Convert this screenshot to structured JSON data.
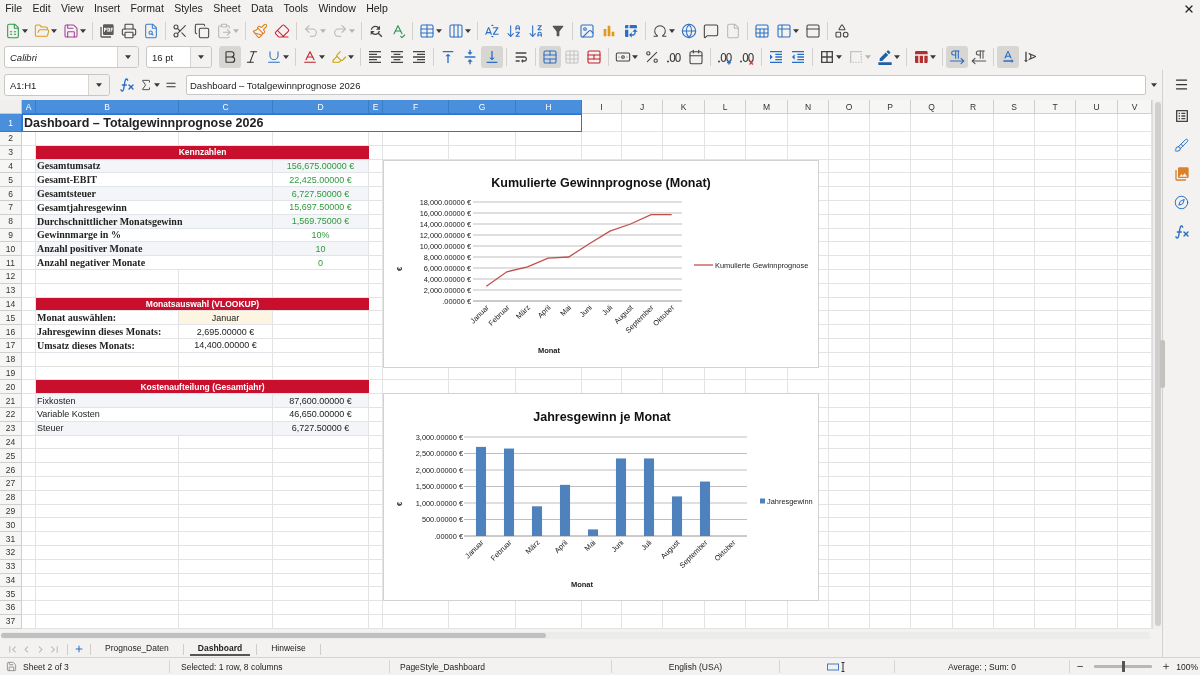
{
  "menu_bar": {
    "items": [
      "File",
      "Edit",
      "View",
      "Insert",
      "Format",
      "Styles",
      "Sheet",
      "Data",
      "Tools",
      "Window",
      "Help"
    ]
  },
  "standard_toolbar": {
    "groups": [
      [
        {
          "kind": "new",
          "dropdown": true,
          "disabled": false
        },
        {
          "kind": "open",
          "dropdown": true,
          "disabled": false
        },
        {
          "kind": "save",
          "dropdown": true,
          "disabled": false
        }
      ],
      [
        {
          "kind": "pdf",
          "dropdown": false,
          "disabled": false
        },
        {
          "kind": "print",
          "dropdown": false,
          "disabled": false
        },
        {
          "kind": "preview",
          "dropdown": false,
          "disabled": false
        }
      ],
      [
        {
          "kind": "cut",
          "dropdown": false,
          "disabled": false
        },
        {
          "kind": "copy",
          "dropdown": false,
          "disabled": false
        },
        {
          "kind": "paste",
          "dropdown": true,
          "disabled": true
        }
      ],
      [
        {
          "kind": "brush",
          "dropdown": false,
          "disabled": false
        },
        {
          "kind": "clear",
          "dropdown": false,
          "disabled": false
        }
      ],
      [
        {
          "kind": "undo",
          "dropdown": true,
          "disabled": true
        },
        {
          "kind": "redo",
          "dropdown": true,
          "disabled": true
        }
      ],
      [
        {
          "kind": "find",
          "dropdown": false,
          "disabled": false
        },
        {
          "kind": "spelling",
          "dropdown": false,
          "disabled": false
        }
      ],
      [
        {
          "kind": "rows",
          "dropdown": true,
          "disabled": false
        },
        {
          "kind": "columns",
          "dropdown": true,
          "disabled": false
        }
      ],
      [
        {
          "kind": "sort",
          "dropdown": false,
          "disabled": false
        },
        {
          "kind": "ascending",
          "dropdown": false,
          "disabled": false
        },
        {
          "kind": "descending",
          "dropdown": false,
          "disabled": false
        },
        {
          "kind": "filter",
          "dropdown": false,
          "disabled": false
        }
      ],
      [
        {
          "kind": "image",
          "dropdown": false,
          "disabled": false
        },
        {
          "kind": "chart",
          "dropdown": false,
          "disabled": false
        },
        {
          "kind": "pivot",
          "dropdown": false,
          "disabled": false
        }
      ],
      [
        {
          "kind": "symbol",
          "dropdown": true,
          "disabled": false
        },
        {
          "kind": "link",
          "dropdown": false,
          "disabled": false
        },
        {
          "kind": "comment",
          "dropdown": false,
          "disabled": false
        },
        {
          "kind": "header",
          "dropdown": false,
          "disabled": true
        }
      ],
      [
        {
          "kind": "printarea",
          "dropdown": false,
          "disabled": false
        },
        {
          "kind": "freeze",
          "dropdown": true,
          "disabled": false
        },
        {
          "kind": "split",
          "dropdown": false,
          "disabled": false
        }
      ],
      [
        {
          "kind": "shapes",
          "dropdown": false,
          "disabled": false
        }
      ]
    ]
  },
  "formatting_toolbar": {
    "font_name": "Calibri",
    "font_size": "16 pt",
    "groups": [
      [
        {
          "kind": "bold",
          "dropdown": false,
          "disabled": false,
          "active": true
        },
        {
          "kind": "italic",
          "dropdown": false,
          "disabled": false,
          "active": false
        },
        {
          "kind": "underline",
          "dropdown": true,
          "disabled": false,
          "active": false
        }
      ],
      [
        {
          "kind": "fontcolor",
          "dropdown": true,
          "disabled": false,
          "active": false
        },
        {
          "kind": "highlight",
          "dropdown": true,
          "disabled": false,
          "active": false
        }
      ],
      [
        {
          "kind": "left",
          "dropdown": false,
          "disabled": false,
          "active": false
        },
        {
          "kind": "center",
          "dropdown": false,
          "disabled": false,
          "active": false
        },
        {
          "kind": "right",
          "dropdown": false,
          "disabled": false,
          "active": false
        }
      ],
      [
        {
          "kind": "top",
          "dropdown": false,
          "disabled": false,
          "active": false
        },
        {
          "kind": "middle",
          "dropdown": false,
          "disabled": false,
          "active": false
        },
        {
          "kind": "bottom",
          "dropdown": false,
          "disabled": false,
          "active": true
        }
      ],
      [
        {
          "kind": "wrap",
          "dropdown": false,
          "disabled": false,
          "active": false
        }
      ],
      [
        {
          "kind": "mergecenter",
          "dropdown": false,
          "disabled": false,
          "active": true
        },
        {
          "kind": "merge",
          "dropdown": false,
          "disabled": true,
          "active": false
        },
        {
          "kind": "unmerge",
          "dropdown": false,
          "disabled": false,
          "active": false
        }
      ],
      [
        {
          "kind": "currency",
          "dropdown": true,
          "disabled": false,
          "active": false
        },
        {
          "kind": "percent",
          "dropdown": false,
          "disabled": false,
          "active": false
        },
        {
          "kind": "number",
          "dropdown": false,
          "disabled": false,
          "active": false
        },
        {
          "kind": "date",
          "dropdown": false,
          "disabled": false,
          "active": false
        }
      ],
      [
        {
          "kind": "adddecimal",
          "dropdown": false,
          "disabled": false,
          "active": false
        },
        {
          "kind": "deldecimal",
          "dropdown": false,
          "disabled": false,
          "active": false
        }
      ],
      [
        {
          "kind": "indent",
          "dropdown": false,
          "disabled": false,
          "active": false
        },
        {
          "kind": "outdent",
          "dropdown": false,
          "disabled": false,
          "active": false
        }
      ],
      [
        {
          "kind": "borders",
          "dropdown": true,
          "disabled": false,
          "active": false
        },
        {
          "kind": "borderstyle",
          "dropdown": true,
          "disabled": true,
          "active": false
        },
        {
          "kind": "bordercolor",
          "dropdown": true,
          "disabled": false,
          "active": false
        }
      ],
      [
        {
          "kind": "conditional",
          "dropdown": true,
          "disabled": false,
          "active": false
        }
      ],
      [
        {
          "kind": "ltr",
          "dropdown": false,
          "disabled": false,
          "active": true
        },
        {
          "kind": "rtl",
          "dropdown": false,
          "disabled": false,
          "active": false
        }
      ],
      [
        {
          "kind": "horizontal",
          "dropdown": false,
          "disabled": false,
          "active": true
        },
        {
          "kind": "vertical",
          "dropdown": false,
          "disabled": false,
          "active": false
        }
      ]
    ]
  },
  "formula_bar": {
    "name_box": "A1:H1",
    "formula": "Dashboard – Totalgewinnprognose 2026"
  },
  "sheet": {
    "columns": [
      {
        "label": "A",
        "selected": true
      },
      {
        "label": "B",
        "selected": true
      },
      {
        "label": "C",
        "selected": true
      },
      {
        "label": "D",
        "selected": true
      },
      {
        "label": "E",
        "selected": true
      },
      {
        "label": "F",
        "selected": true
      },
      {
        "label": "G",
        "selected": true
      },
      {
        "label": "H",
        "selected": true
      },
      {
        "label": "I",
        "selected": false
      },
      {
        "label": "J",
        "selected": false
      },
      {
        "label": "K",
        "selected": false
      },
      {
        "label": "L",
        "selected": false
      },
      {
        "label": "M",
        "selected": false
      },
      {
        "label": "N",
        "selected": false
      },
      {
        "label": "O",
        "selected": false
      },
      {
        "label": "P",
        "selected": false
      },
      {
        "label": "Q",
        "selected": false
      },
      {
        "label": "R",
        "selected": false
      },
      {
        "label": "S",
        "selected": false
      },
      {
        "label": "T",
        "selected": false
      },
      {
        "label": "U",
        "selected": false
      },
      {
        "label": "V",
        "selected": false
      }
    ],
    "rows": [
      {
        "label": "1",
        "selected": true
      },
      {
        "label": "2",
        "selected": false
      },
      {
        "label": "3",
        "selected": false
      },
      {
        "label": "4",
        "selected": false
      },
      {
        "label": "5",
        "selected": false
      },
      {
        "label": "6",
        "selected": false
      },
      {
        "label": "7",
        "selected": false
      },
      {
        "label": "8",
        "selected": false
      },
      {
        "label": "9",
        "selected": false
      },
      {
        "label": "10",
        "selected": false
      },
      {
        "label": "11",
        "selected": false
      },
      {
        "label": "12",
        "selected": false
      },
      {
        "label": "13",
        "selected": false
      },
      {
        "label": "14",
        "selected": false
      },
      {
        "label": "15",
        "selected": false
      },
      {
        "label": "16",
        "selected": false
      },
      {
        "label": "17",
        "selected": false
      },
      {
        "label": "18",
        "selected": false
      },
      {
        "label": "19",
        "selected": false
      },
      {
        "label": "20",
        "selected": false
      },
      {
        "label": "21",
        "selected": false
      },
      {
        "label": "22",
        "selected": false
      },
      {
        "label": "23",
        "selected": false
      },
      {
        "label": "24",
        "selected": false
      },
      {
        "label": "25",
        "selected": false
      },
      {
        "label": "26",
        "selected": false
      },
      {
        "label": "27",
        "selected": false
      },
      {
        "label": "28",
        "selected": false
      },
      {
        "label": "29",
        "selected": false
      },
      {
        "label": "30",
        "selected": false
      },
      {
        "label": "31",
        "selected": false
      },
      {
        "label": "32",
        "selected": false
      },
      {
        "label": "33",
        "selected": false
      },
      {
        "label": "34",
        "selected": false
      },
      {
        "label": "35",
        "selected": false
      },
      {
        "label": "36",
        "selected": false
      },
      {
        "label": "37",
        "selected": false
      }
    ],
    "title": {
      "text": "Dashboard – Totalgewinnprognose 2026",
      "selected": true
    },
    "blocks": [
      {
        "kind": "kpi",
        "header": "Kennzahlen",
        "rows": [
          {
            "label": "Gesamtumsatz",
            "value": "156,675.00000 €"
          },
          {
            "label": "Gesamt-EBIT",
            "value": "22,425.00000 €"
          },
          {
            "label": "Gesamtsteuer",
            "value": "6,727.50000 €"
          },
          {
            "label": "Gesamtjahresgewinn",
            "value": "15,697.50000 €"
          },
          {
            "label": "Durchschnittlicher Monatsgewinn",
            "value": "1,569.75000 €"
          },
          {
            "label": "Gewinnmarge in %",
            "value": "10%"
          },
          {
            "label": "Anzahl positiver Monate",
            "value": "10"
          },
          {
            "label": "Anzahl negativer Monate",
            "value": "0"
          }
        ]
      },
      {
        "kind": "lookup",
        "header": "Monatsauswahl (VLOOKUP)",
        "rows": [
          {
            "kind": "select",
            "label": "Monat auswählen:",
            "value": "Januar"
          },
          {
            "kind": "result",
            "label": "Jahresgewinn dieses Monats:",
            "value": "2,695.00000 €"
          },
          {
            "kind": "result",
            "label": "Umsatz dieses Monats:",
            "value": "14,400.00000 €"
          }
        ]
      },
      {
        "kind": "breakdown",
        "header": "Kostenaufteilung (Gesamtjahr)",
        "rows": [
          {
            "label": "Fixkosten",
            "value": "87,600.00000 €"
          },
          {
            "label": "Variable Kosten",
            "value": "46,650.00000 €"
          },
          {
            "label": "Steuer",
            "value": "6,727.50000 €"
          }
        ]
      }
    ],
    "charts": [
      {
        "chart_data": {
          "type": "line",
          "title": "Kumulierte Gewinnprognose (Monat)",
          "xlabel": "Monat",
          "ylabel": "€",
          "categories": [
            "Januar",
            "Februar",
            "März",
            "April",
            "Mai",
            "Juni",
            "Juli",
            "August",
            "September",
            "Oktober"
          ],
          "series": [
            {
              "name": "Kumulierte Gewinnprognose",
              "color": "#c0504d",
              "values": [
                2700,
                5300,
                6200,
                7800,
                8000,
                10400,
                12700,
                14000,
                15700,
                15700
              ]
            }
          ],
          "ylim": [
            0,
            18000
          ],
          "yticks": [
            {
              "value": 0,
              "label": ".00000 €"
            },
            {
              "value": 2000,
              "label": "2,000.00000 €"
            },
            {
              "value": 4000,
              "label": "4,000.00000 €"
            },
            {
              "value": 6000,
              "label": "6,000.00000 €"
            },
            {
              "value": 8000,
              "label": "8,000.00000 €"
            },
            {
              "value": 10000,
              "label": "10,000.00000 €"
            },
            {
              "value": 12000,
              "label": "12,000.00000 €"
            },
            {
              "value": 14000,
              "label": "14,000.00000 €"
            },
            {
              "value": 16000,
              "label": "16,000.00000 €"
            },
            {
              "value": 18000,
              "label": "18,000.00000 €"
            }
          ],
          "grid": true
        }
      },
      {
        "chart_data": {
          "type": "bar",
          "title": "Jahresgewinn je Monat",
          "xlabel": "Monat",
          "ylabel": "€",
          "categories": [
            "Januar",
            "Februar",
            "März",
            "April",
            "Mai",
            "Juni",
            "Juli",
            "August",
            "September",
            "Oktober"
          ],
          "series": [
            {
              "name": "Jahresgewinn",
              "color": "#4f81bd",
              "values": [
                2700,
                2650,
                900,
                1550,
                200,
                2350,
                2350,
                1200,
                1650,
                0
              ]
            }
          ],
          "ylim": [
            0,
            3000
          ],
          "yticks": [
            {
              "value": 0,
              "label": ".00000 €"
            },
            {
              "value": 500,
              "label": "500.00000 €"
            },
            {
              "value": 1000,
              "label": "1,000.00000 €"
            },
            {
              "value": 1500,
              "label": "1,500.00000 €"
            },
            {
              "value": 2000,
              "label": "2,000.00000 €"
            },
            {
              "value": 2500,
              "label": "2,500.00000 €"
            },
            {
              "value": 3000,
              "label": "3,000.00000 €"
            }
          ],
          "grid": true
        }
      }
    ]
  },
  "sheet_tab_bar": {
    "navigation_disabled": true,
    "tabs": [
      {
        "label": "Prognose_Daten",
        "selected": false
      },
      {
        "label": "Dashboard",
        "selected": true
      },
      {
        "label": "Hinweise",
        "selected": false
      }
    ]
  },
  "status_bar": {
    "sheet": "Sheet 2 of 3",
    "selection": "Selected: 1 row, 8 columns",
    "page_style": "PageStyle_Dashboard",
    "language": "English (USA)",
    "summary": "Average: ; Sum: 0",
    "zoom": {
      "level": 0.5,
      "reading": "100%"
    }
  }
}
